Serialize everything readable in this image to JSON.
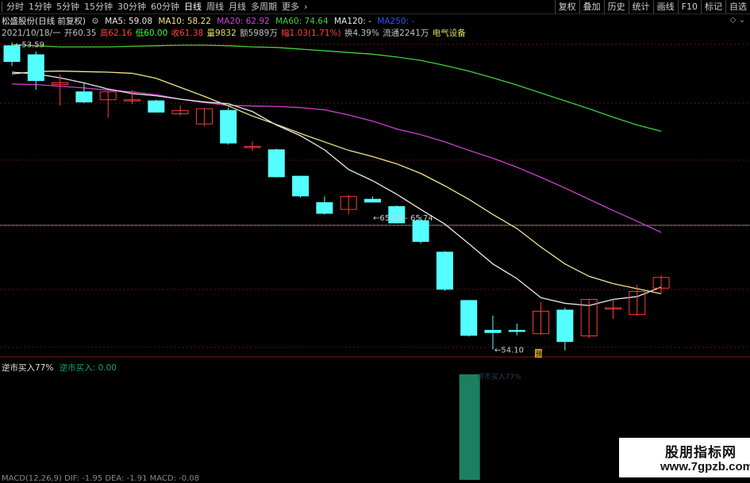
{
  "toolbar": {
    "periods": [
      {
        "label": "分时"
      },
      {
        "label": "1分钟"
      },
      {
        "label": "5分钟"
      },
      {
        "label": "15分钟"
      },
      {
        "label": "30分钟"
      },
      {
        "label": "60分钟"
      },
      {
        "label": "日线",
        "active": true
      },
      {
        "label": "周线"
      },
      {
        "label": "月线"
      },
      {
        "label": "多周期"
      },
      {
        "label": "更多"
      }
    ],
    "more_icon": "chevron-right-icon",
    "right_buttons": [
      {
        "label": "复权"
      },
      {
        "label": "叠加"
      },
      {
        "label": "历史"
      },
      {
        "label": "统计"
      },
      {
        "label": "画线"
      },
      {
        "label": "F10"
      },
      {
        "label": "标记"
      },
      {
        "label": "自选"
      }
    ]
  },
  "title": {
    "stock": "松盛股份(日线 前复权)",
    "ma5": "MA5: 59.08",
    "ma10": "MA10: 58.22",
    "ma20": "MA20: 62.92",
    "ma60": "MA60: 74.64",
    "ma120": "MA120: -",
    "ma250": "MA250: -"
  },
  "info": {
    "date": "2021/10/18/一",
    "open": "开60.35",
    "high": "高62.16",
    "low": "低60.00",
    "close": "收61.38",
    "vol": "量9832",
    "amount": "额5989万",
    "change": "幅1.03(1.71%)",
    "turnover": "换4.39%",
    "float": "流通2241万",
    "sector": "电气设备"
  },
  "annotations": {
    "high": "53.59",
    "low": "54.10",
    "range": "65.88 - 65.74",
    "tag": "预"
  },
  "indicator": {
    "title": "逆市买入77%",
    "value": "逆市买入: 0.00",
    "bar_label": "逆市买入77%"
  },
  "bottom": {
    "text": "MACD(12,26,9) DIF: -1.95 DEA: -1.91 MACD: -0.08"
  },
  "watermark": {
    "cn": "股朋指标网",
    "url": "www.7gpzb.com"
  },
  "colors": {
    "up": "#ff3b3b",
    "down": "#54ffff",
    "ma5": "#e8e8e8",
    "ma10": "#f0e68c",
    "ma20": "#d040d0",
    "ma60": "#40d040",
    "indicator": "#1a8060"
  },
  "candles": [
    {
      "o": 59.2,
      "h": 59.8,
      "l": 55.6,
      "c": 56.4
    },
    {
      "o": 57.6,
      "h": 58.2,
      "l": 51.4,
      "c": 53.0
    },
    {
      "o": 52.3,
      "h": 54.1,
      "l": 48.6,
      "c": 52.6
    },
    {
      "o": 51.0,
      "h": 52.6,
      "l": 49.0,
      "c": 49.2
    },
    {
      "o": 49.6,
      "h": 51.0,
      "l": 46.4,
      "c": 51.0
    },
    {
      "o": 49.5,
      "h": 51.3,
      "l": 48.8,
      "c": 49.6
    },
    {
      "o": 49.4,
      "h": 49.6,
      "l": 47.3,
      "c": 47.4
    },
    {
      "o": 47.1,
      "h": 48.6,
      "l": 46.7,
      "c": 47.7
    },
    {
      "o": 45.3,
      "h": 48.1,
      "l": 44.9,
      "c": 48.0
    },
    {
      "o": 47.7,
      "h": 48.2,
      "l": 41.6,
      "c": 41.9
    },
    {
      "o": 41.2,
      "h": 42.2,
      "l": 40.5,
      "c": 41.3
    },
    {
      "o": 40.7,
      "h": 40.9,
      "l": 35.8,
      "c": 35.9
    },
    {
      "o": 36.0,
      "h": 36.1,
      "l": 32.2,
      "c": 32.5
    },
    {
      "o": 31.3,
      "h": 32.4,
      "l": 29.2,
      "c": 29.4
    },
    {
      "o": 30.1,
      "h": 32.7,
      "l": 29.2,
      "c": 32.4
    },
    {
      "o": 31.9,
      "h": 32.4,
      "l": 31.3,
      "c": 31.4
    },
    {
      "o": 30.6,
      "h": 30.8,
      "l": 27.6,
      "c": 27.7
    },
    {
      "o": 28.1,
      "h": 28.8,
      "l": 24.0,
      "c": 24.4
    },
    {
      "o": 22.5,
      "h": 22.7,
      "l": 15.6,
      "c": 15.9
    },
    {
      "o": 13.9,
      "h": 13.9,
      "l": 7.5,
      "c": 7.7
    },
    {
      "o": 8.6,
      "h": 11.2,
      "l": 5.2,
      "c": 8.2
    },
    {
      "o": 8.6,
      "h": 9.8,
      "l": 7.7,
      "c": 8.4
    },
    {
      "o": 8.0,
      "h": 13.6,
      "l": 7.8,
      "c": 12.0
    },
    {
      "o": 12.2,
      "h": 12.6,
      "l": 5.0,
      "c": 6.6
    },
    {
      "o": 7.6,
      "h": 14.2,
      "l": 7.2,
      "c": 14.1
    },
    {
      "o": 12.5,
      "h": 14.1,
      "l": 10.6,
      "c": 12.6
    },
    {
      "o": 11.4,
      "h": 16.7,
      "l": 11.2,
      "c": 15.5
    },
    {
      "o": 16.1,
      "h": 18.4,
      "l": 15.1,
      "c": 18.0
    }
  ],
  "ma5_vals": [
    54.5,
    54.2,
    53.5,
    52.6,
    51.5,
    50.7,
    50.3,
    49.7,
    49.2,
    48.9,
    47.5,
    45.1,
    43.2,
    40.7,
    37.2,
    35.2,
    32.8,
    30.1,
    27.5,
    24.0,
    20.4,
    17.8,
    14.4,
    13.4,
    13.0,
    14.1,
    14.6,
    16.3
  ],
  "ma10_vals": [
    54.2,
    54.6,
    54.7,
    54.6,
    54.5,
    54.3,
    53.4,
    51.8,
    50.2,
    48.5,
    46.7,
    45.2,
    43.6,
    42.1,
    40.6,
    39.5,
    38.2,
    36.5,
    34.3,
    31.9,
    29.2,
    26.7,
    23.4,
    20.4,
    18.2,
    16.9,
    16.0,
    15.1
  ],
  "ma20_vals": [
    52.4,
    52.3,
    52.0,
    51.7,
    51.3,
    51.0,
    50.5,
    49.7,
    49.1,
    48.6,
    48.5,
    48.4,
    48.2,
    47.8,
    46.9,
    45.8,
    44.4,
    43.4,
    42.1,
    40.6,
    39.2,
    37.6,
    35.8,
    33.9,
    31.9,
    29.9,
    28.0,
    26.0
  ],
  "ma60_vals": [
    59.4,
    59.2,
    59.0,
    59.0,
    59.0,
    59.1,
    59.2,
    59.3,
    59.3,
    59.2,
    59.0,
    58.9,
    58.6,
    58.3,
    58.0,
    57.7,
    57.2,
    56.6,
    55.7,
    54.7,
    53.5,
    52.2,
    50.8,
    49.4,
    48.0,
    46.5,
    45.1,
    44.0
  ],
  "indicator_bar": {
    "index": 19,
    "value": 1.0
  }
}
